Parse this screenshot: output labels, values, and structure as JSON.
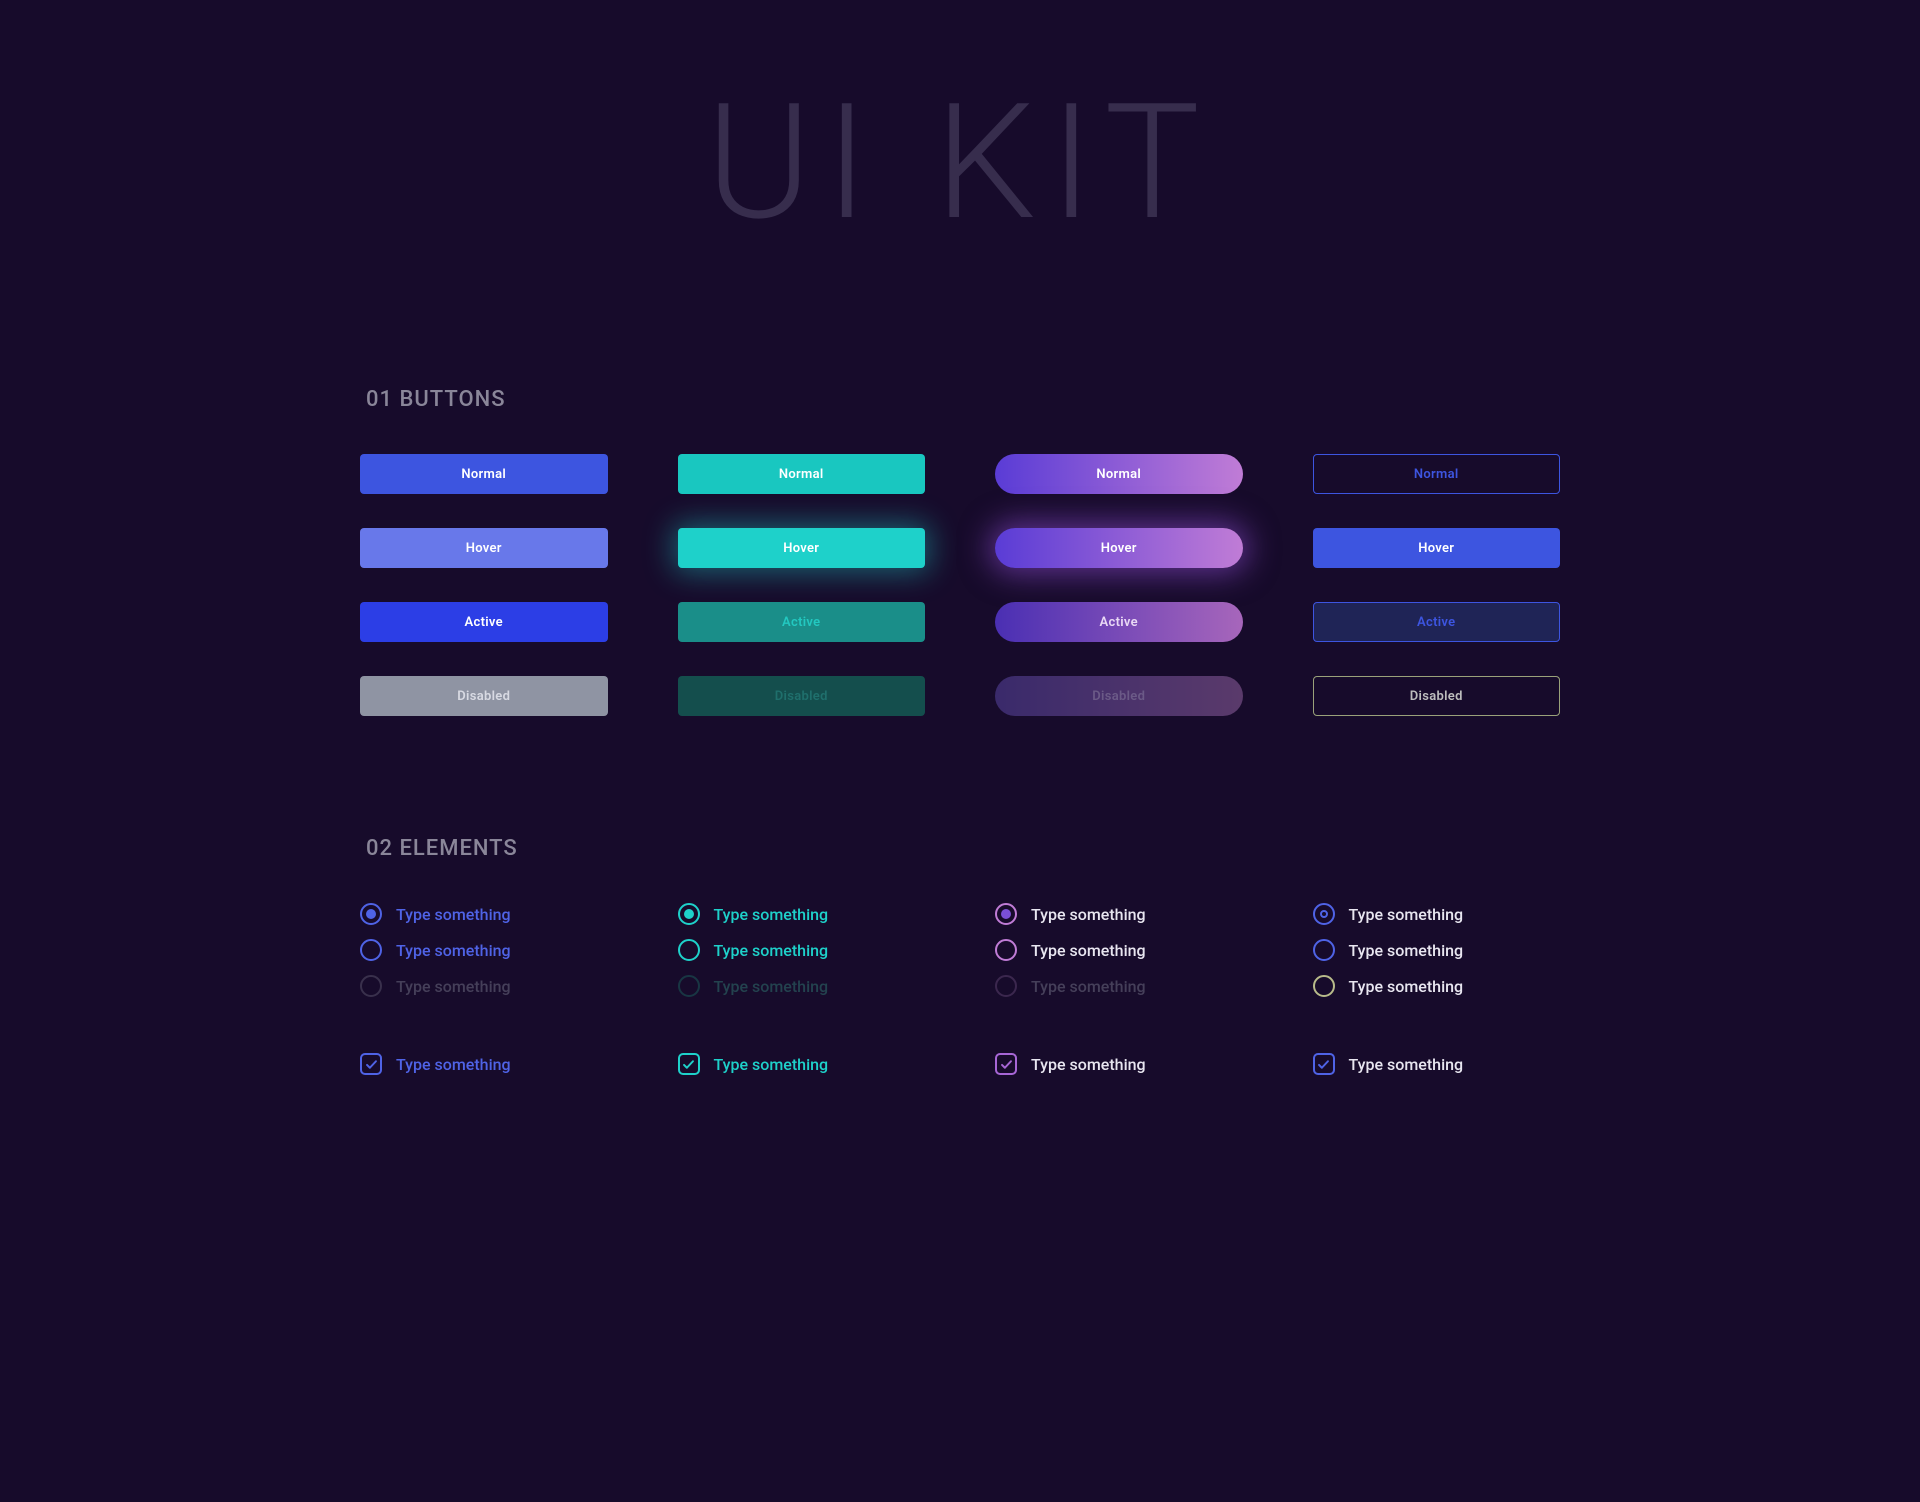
{
  "hero": {
    "title": "UI KIT"
  },
  "sections": {
    "buttons": {
      "title": "01 BUTTONS"
    },
    "elements": {
      "title": "02 ELEMENTS"
    }
  },
  "button_states": {
    "normal": "Normal",
    "hover": "Hover",
    "active": "Active",
    "disabled": "Disabled"
  },
  "element_label": "Type something",
  "colors": {
    "bg": "#170b2b",
    "blue": "#3d55e0",
    "blue_hover": "#6878ea",
    "blue_active": "#2c3ee6",
    "teal": "#1ed1ca",
    "teal_dark": "#1a8e89",
    "grad_a": "#5a3cd6",
    "grad_b": "#c07cd6",
    "outline_disabled": "#9aa27a",
    "gray": "#8f94a3"
  }
}
